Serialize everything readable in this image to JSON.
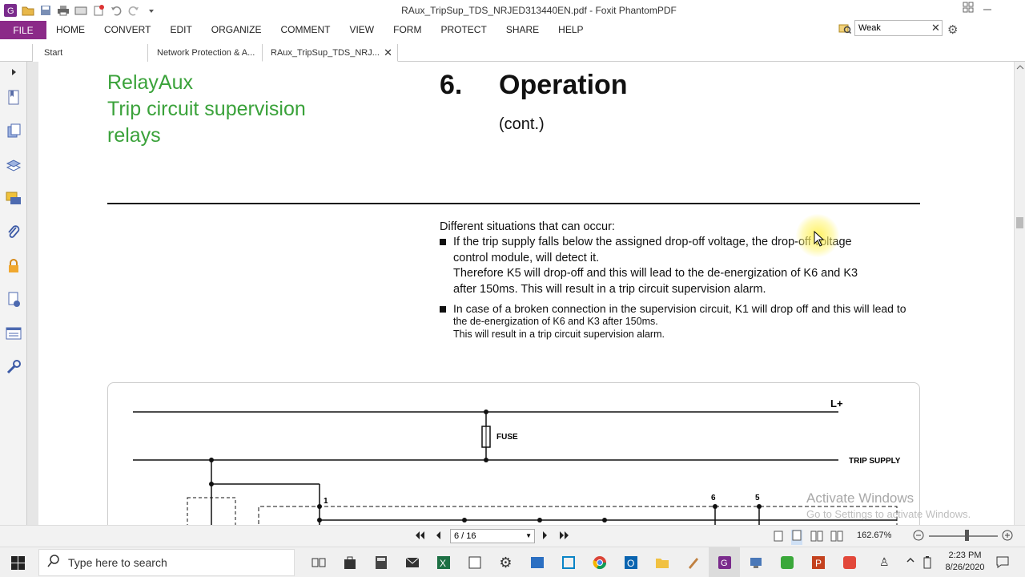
{
  "window": {
    "title": "RAux_TripSup_TDS_NRJED313440EN.pdf - Foxit PhantomPDF"
  },
  "ribbon": {
    "file_label": "FILE",
    "tabs": [
      "HOME",
      "CONVERT",
      "EDIT",
      "ORGANIZE",
      "COMMENT",
      "VIEW",
      "FORM",
      "PROTECT",
      "SHARE",
      "HELP"
    ]
  },
  "search": {
    "value": "Weak"
  },
  "doc_tabs": [
    {
      "label": "Start"
    },
    {
      "label": "Network Protection & A..."
    },
    {
      "label": "RAux_TripSup_TDS_NRJ..."
    }
  ],
  "document": {
    "product_title": [
      "RelayAux",
      "Trip circuit supervision",
      "relays"
    ],
    "section_number": "6.",
    "section_title": "Operation",
    "section_cont": "(cont.)",
    "intro": "Different situations that can occur:",
    "bullet1": [
      "If the trip supply falls below the assigned drop-off voltage, the drop-off voltage",
      "control module, will detect it.",
      "Therefore K5 will drop-off and this will lead to the de-energization of K6 and K3",
      "after 150ms. This will result in a trip circuit supervision alarm."
    ],
    "bullet2": [
      "In case of a broken connection in the supervision circuit, K1 will drop off and this will lead to",
      "the de-energization of K6 and K3 after 150ms.",
      "This will result in a trip circuit supervision alarm."
    ],
    "diagram": {
      "l_plus": "L+",
      "fuse": "FUSE",
      "trip_supply": "TRIP SUPPLY",
      "terminal_1": "1",
      "terminal_6": "6",
      "terminal_5": "5"
    }
  },
  "watermark": {
    "line1": "Activate Windows",
    "line2": "Go to Settings to activate Windows."
  },
  "statusbar": {
    "page": "6 / 16",
    "zoom": "162.67%"
  },
  "taskbar": {
    "search_placeholder": "Type here to search",
    "time": "2:23 PM",
    "date": "8/26/2020"
  }
}
